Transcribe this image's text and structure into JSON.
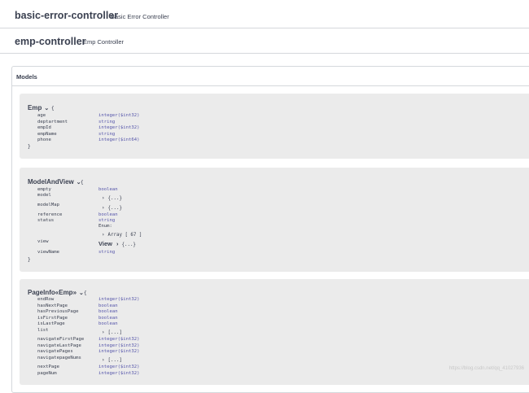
{
  "controllers": [
    {
      "name": "basic-error-controller",
      "description": "Basic Error Controller"
    },
    {
      "name": "emp-controller",
      "description": "Emp Controller"
    }
  ],
  "models": {
    "title": "Models",
    "emp": {
      "title": "Emp",
      "chevron": "⌄",
      "open": "{",
      "close": "}",
      "props": [
        {
          "name": "age",
          "type": "integer($int32)"
        },
        {
          "name": "deptartment",
          "type": "string"
        },
        {
          "name": "empId",
          "type": "integer($int32)"
        },
        {
          "name": "empName",
          "type": "string"
        },
        {
          "name": "phone",
          "type": "integer($int64)"
        }
      ]
    },
    "modelAndView": {
      "title": "ModelAndView",
      "chevron": "⌄",
      "open": "{",
      "close": "}",
      "props": [
        {
          "name": "empty",
          "type": "boolean"
        },
        {
          "name": "model",
          "type": ""
        },
        {
          "name": "modelMap",
          "type": ""
        },
        {
          "name": "reference",
          "type": "boolean"
        },
        {
          "name": "status",
          "type": "string"
        },
        {
          "name": "view",
          "type": ""
        },
        {
          "name": "viewName",
          "type": "string"
        }
      ],
      "model_collapse": "{...}",
      "modelmap_collapse": "{...}",
      "enum_label": "Enum:",
      "enum_array": "Array [ 67 ]",
      "view_ref": "View",
      "view_collapse": "{...}"
    },
    "pageInfo": {
      "title": "PageInfo«Emp»",
      "chevron": "⌄",
      "open": "{",
      "props": [
        {
          "name": "endRow",
          "type": "integer($int32)"
        },
        {
          "name": "hasNextPage",
          "type": "boolean"
        },
        {
          "name": "hasPreviousPage",
          "type": "boolean"
        },
        {
          "name": "isFirstPage",
          "type": "boolean"
        },
        {
          "name": "isLastPage",
          "type": "boolean"
        },
        {
          "name": "list",
          "type": ""
        },
        {
          "name": "navigateFirstPage",
          "type": "integer($int32)"
        },
        {
          "name": "navigateLastPage",
          "type": "integer($int32)"
        },
        {
          "name": "navigatePages",
          "type": "integer($int32)"
        },
        {
          "name": "navigatepageNums",
          "type": ""
        },
        {
          "name": "nextPage",
          "type": "integer($int32)"
        },
        {
          "name": "pageNum",
          "type": "integer($int32)"
        }
      ],
      "list_collapse": "[...]",
      "navnums_collapse": "[...]"
    }
  },
  "watermark": "https://blog.csdn.net/qq_41027936"
}
